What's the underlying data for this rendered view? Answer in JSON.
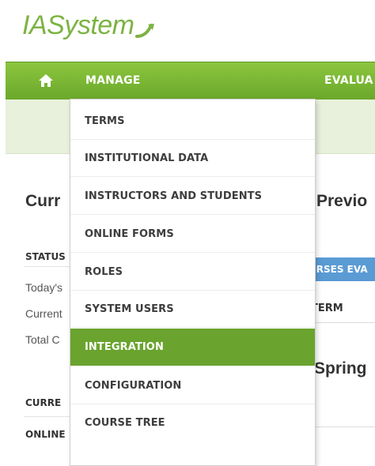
{
  "logo": {
    "text_ias": "IAS",
    "text_system": "ystem"
  },
  "nav": {
    "home_icon": "home-icon",
    "manage_label": "MANAGE",
    "evaluations_label": "EVALUA"
  },
  "left": {
    "title": "Curr",
    "status_label": "STATUS",
    "rows": [
      "Today's",
      "Current",
      "Total C"
    ],
    "sections": [
      "CURRE",
      "ONLINE"
    ]
  },
  "right": {
    "title": "Previo",
    "tab_label": "URSES EVA",
    "column_header": "TERM",
    "term_title": "Spring"
  },
  "menu": {
    "items": [
      {
        "label": "TERMS",
        "active": false
      },
      {
        "label": "INSTITUTIONAL DATA",
        "active": false
      },
      {
        "label": "INSTRUCTORS AND STUDENTS",
        "active": false
      },
      {
        "label": "ONLINE FORMS",
        "active": false
      },
      {
        "label": "ROLES",
        "active": false
      },
      {
        "label": "SYSTEM USERS",
        "active": false
      },
      {
        "label": "INTEGRATION",
        "active": true
      },
      {
        "label": "CONFIGURATION",
        "active": false
      },
      {
        "label": "COURSE TREE",
        "active": false
      }
    ]
  },
  "colors": {
    "brand_green": "#7cb342",
    "nav_green": "#6aa82a",
    "active_item": "#6aa32e",
    "subbar": "#e8f1dc",
    "tab_blue": "#5a9bd4"
  }
}
